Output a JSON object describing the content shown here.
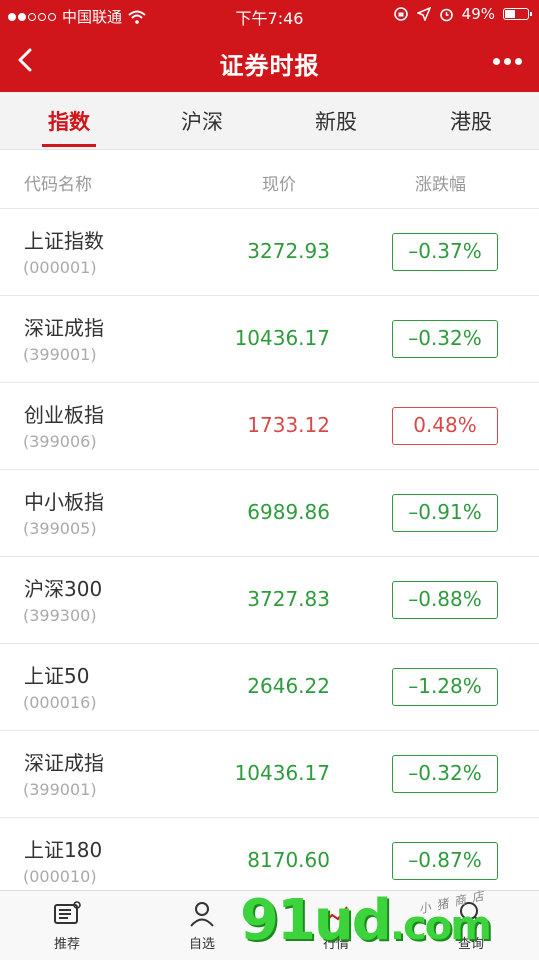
{
  "status": {
    "carrier": "中国联通",
    "time": "下午7:46",
    "battery": "49%",
    "battery_fraction": 0.49
  },
  "header": {
    "title": "证券时报"
  },
  "tabs": [
    {
      "label": "指数"
    },
    {
      "label": "沪深"
    },
    {
      "label": "新股"
    },
    {
      "label": "港股"
    }
  ],
  "table": {
    "columns": [
      "代码名称",
      "现价",
      "涨跌幅"
    ],
    "rows": [
      {
        "name": "上证指数",
        "code": "(000001)",
        "price": "3272.93",
        "change": "–0.37%",
        "direction": "down"
      },
      {
        "name": "深证成指",
        "code": "(399001)",
        "price": "10436.17",
        "change": "–0.32%",
        "direction": "down"
      },
      {
        "name": "创业板指",
        "code": "(399006)",
        "price": "1733.12",
        "change": "0.48%",
        "direction": "up"
      },
      {
        "name": "中小板指",
        "code": "(399005)",
        "price": "6989.86",
        "change": "–0.91%",
        "direction": "down"
      },
      {
        "name": "沪深300",
        "code": "(399300)",
        "price": "3727.83",
        "change": "–0.88%",
        "direction": "down"
      },
      {
        "name": "上证50",
        "code": "(000016)",
        "price": "2646.22",
        "change": "–1.28%",
        "direction": "down"
      },
      {
        "name": "深证成指",
        "code": "(399001)",
        "price": "10436.17",
        "change": "–0.32%",
        "direction": "down"
      },
      {
        "name": "上证180",
        "code": "(000010)",
        "price": "8170.60",
        "change": "–0.87%",
        "direction": "down"
      }
    ]
  },
  "bottom_nav": [
    {
      "label": "推荐",
      "icon": "news-icon"
    },
    {
      "label": "自选",
      "icon": "person-icon"
    },
    {
      "label": "行情",
      "icon": "chart-icon"
    },
    {
      "label": "查询",
      "icon": "search-icon"
    }
  ],
  "watermark": {
    "main": "91ud",
    "suffix": ".com",
    "small": "小猪商店"
  },
  "colors": {
    "brand_red": "#d0161b",
    "down_green": "#2e9b3c",
    "up_red": "#d84a4a"
  }
}
